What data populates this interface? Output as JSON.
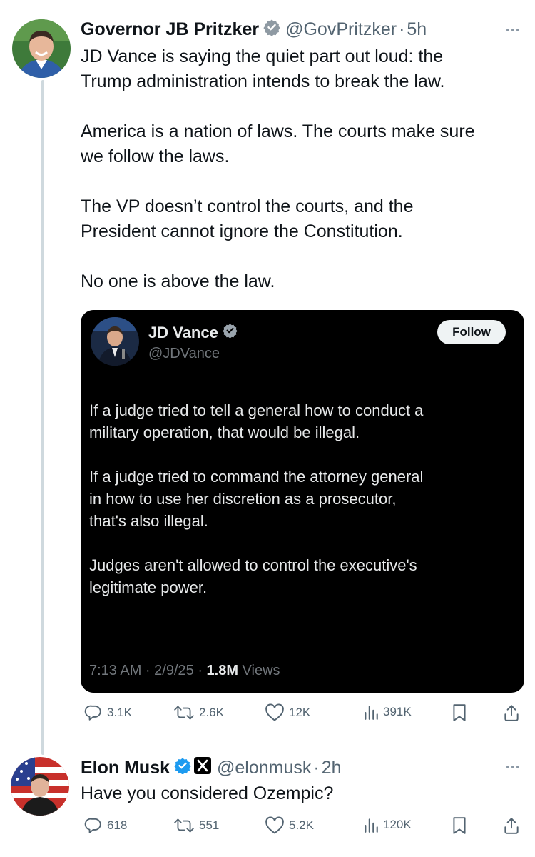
{
  "posts": [
    {
      "name": "Governor JB Pritzker",
      "handle": "@GovPritzker",
      "time": "5h",
      "paragraphs": [
        "JD Vance is saying the quiet part out loud: the",
        "Trump administration intends to break the law.",
        "America is a nation of laws. The courts make sure",
        "we follow the laws.",
        "The VP doesn’t control the courts, and the",
        "President cannot ignore the Constitution.",
        "No one is above the law."
      ],
      "stats": {
        "replies": "3.1K",
        "reposts": "2.6K",
        "likes": "12K",
        "views": "391K"
      }
    },
    {
      "name": "Elon Musk",
      "handle": "@elonmusk",
      "time": "2h",
      "text": "Have you considered Ozempic?",
      "stats": {
        "replies": "618",
        "reposts": "551",
        "likes": "5.2K",
        "views": "120K"
      }
    }
  ],
  "quote": {
    "name": "JD Vance",
    "handle": "@JDVance",
    "follow_label": "Follow",
    "lines": [
      "If a judge tried to tell a general how to conduct a",
      "military operation, that would be illegal.",
      "If a judge tried to command the attorney general",
      "in how to use her discretion as a prosecutor,",
      "that's also illegal.",
      "Judges aren't allowed to control the executive's",
      "legitimate power."
    ],
    "timestamp": "7:13 AM · 2/9/25 · ",
    "views_count": "1.8M",
    "views_label": " Views"
  },
  "separator": "·",
  "colors": {
    "verified": "#1d9bf0",
    "text": "#0f1419",
    "muted": "#536471",
    "card_bg": "#000000"
  }
}
